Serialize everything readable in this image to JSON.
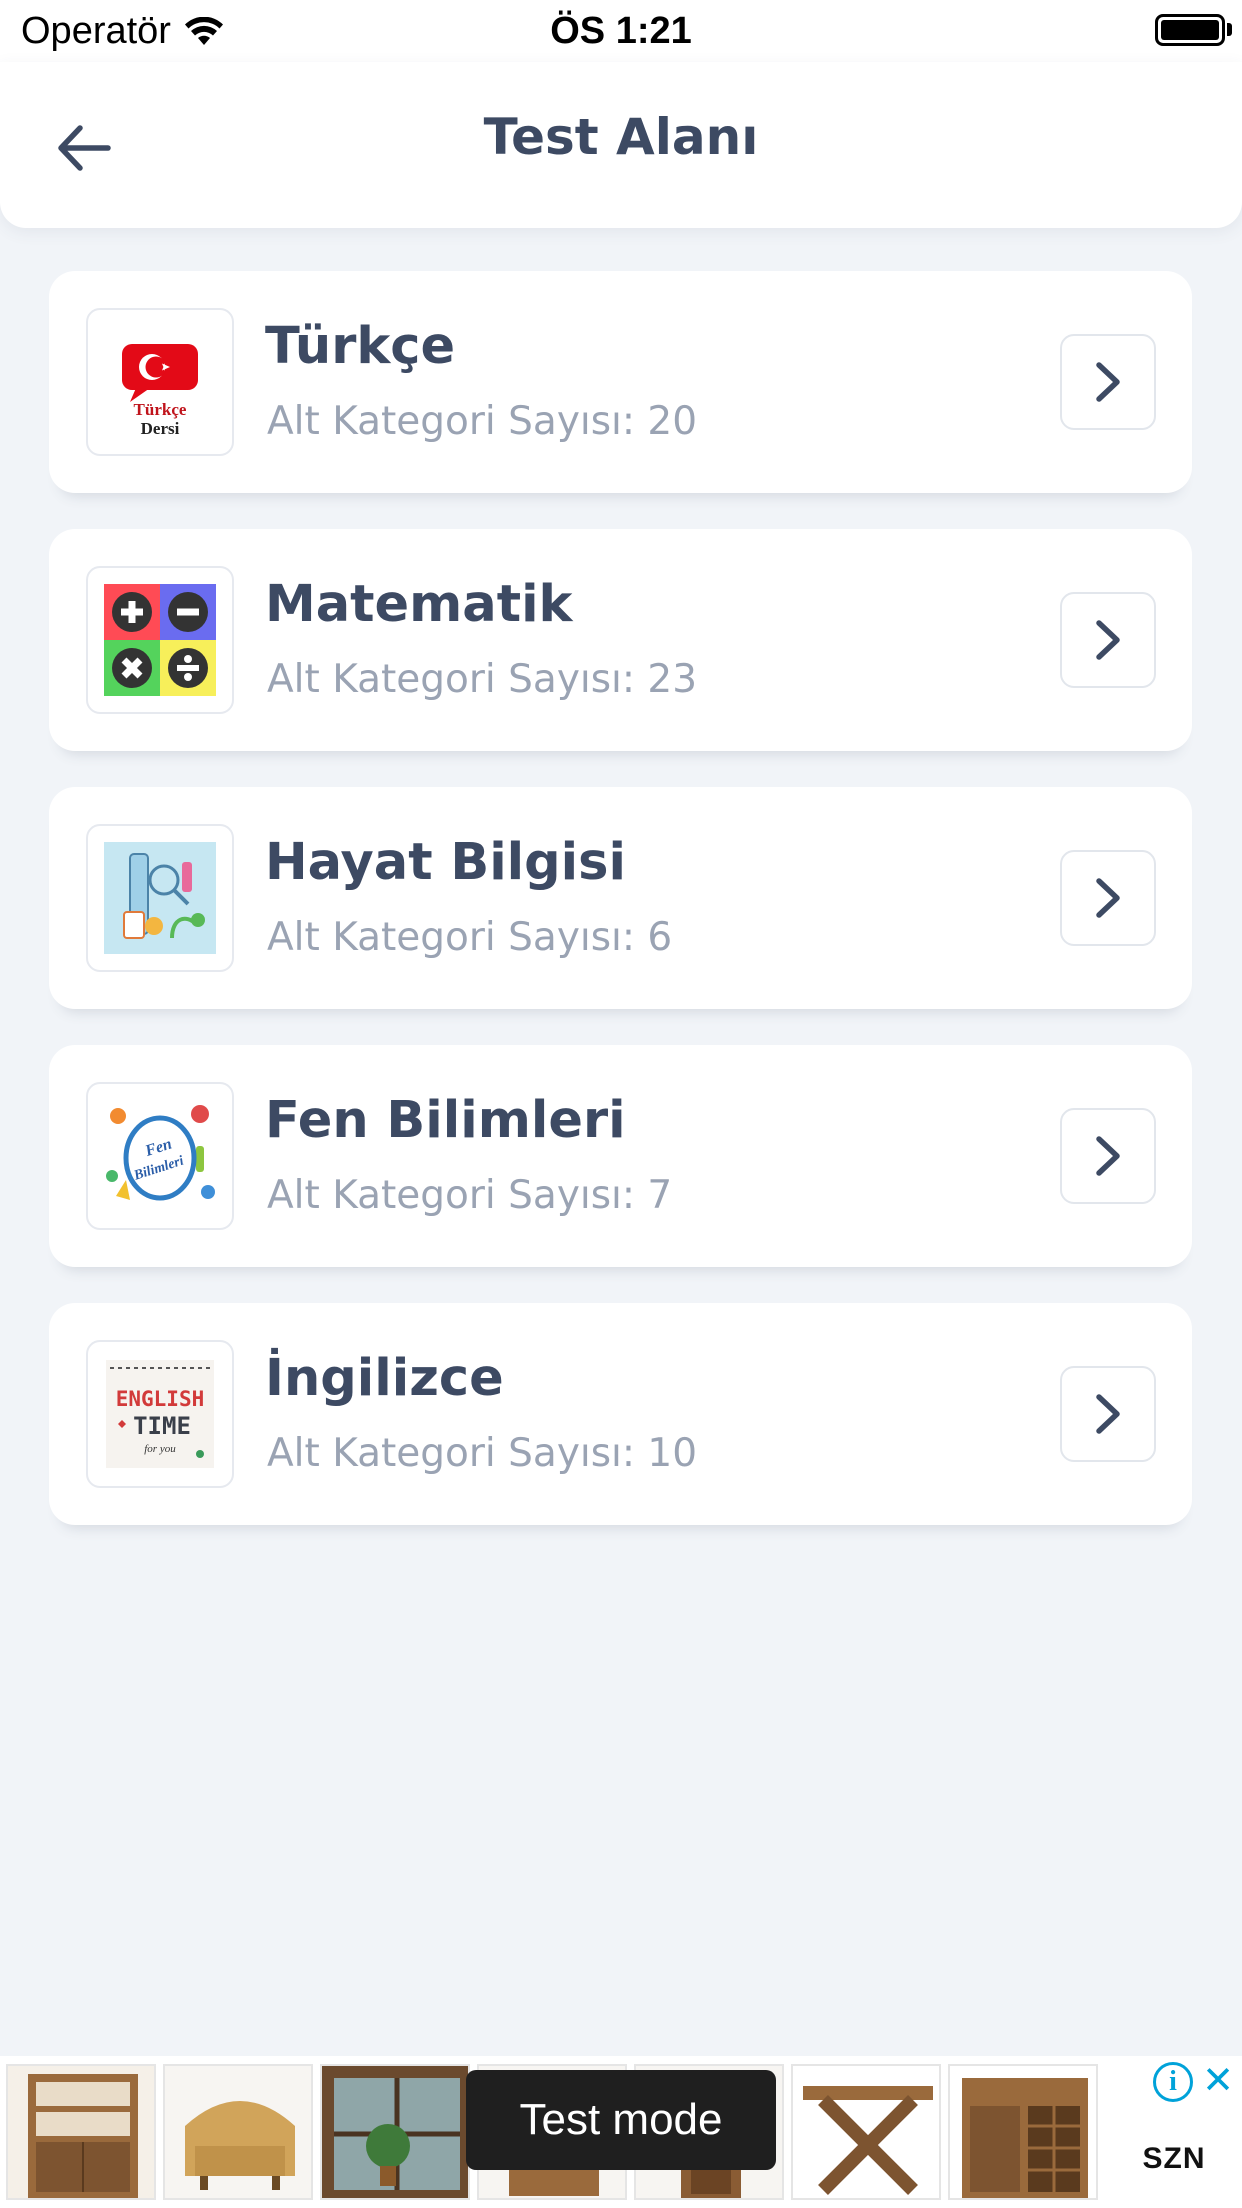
{
  "status_bar": {
    "carrier": "Operatör",
    "time": "ÖS 1:21"
  },
  "header": {
    "title": "Test Alanı",
    "back_icon": "arrow-left-icon"
  },
  "categories": [
    {
      "title": "Türkçe",
      "subtitle": "Alt Kategori Sayısı: 20",
      "thumb_icon": "turkish-flag-speech-icon",
      "thumb_text_1": "Türkçe",
      "thumb_text_2": "Dersi"
    },
    {
      "title": "Matematik",
      "subtitle": "Alt Kategori Sayısı: 23",
      "thumb_icon": "math-operators-icon"
    },
    {
      "title": "Hayat Bilgisi",
      "subtitle": "Alt Kategori Sayısı: 6",
      "thumb_icon": "life-science-illustration"
    },
    {
      "title": "Fen Bilimleri",
      "subtitle": "Alt Kategori Sayısı: 7",
      "thumb_icon": "science-illustration",
      "thumb_text_1": "Fen",
      "thumb_text_2": "Bilimleri"
    },
    {
      "title": "İngilizce",
      "subtitle": "Alt Kategori Sayısı: 10",
      "thumb_icon": "english-time-illustration",
      "thumb_text_1": "ENGLISH",
      "thumb_text_2": "TIME",
      "thumb_text_3": "for you"
    }
  ],
  "ad": {
    "label": "Test mode",
    "info_icon": "info-icon",
    "close_icon": "close-icon",
    "logo_text": "SZN",
    "product_icons": [
      "bookcase-image",
      "armchair-image",
      "window-plant-image",
      "cabinet-image",
      "table-image",
      "wine-cabinet-image"
    ]
  },
  "colors": {
    "background": "#f1f4f8",
    "text_primary": "#3d4a63",
    "text_secondary": "#9aa3b3",
    "card": "#ffffff",
    "ad_accent": "#00a2d9"
  }
}
